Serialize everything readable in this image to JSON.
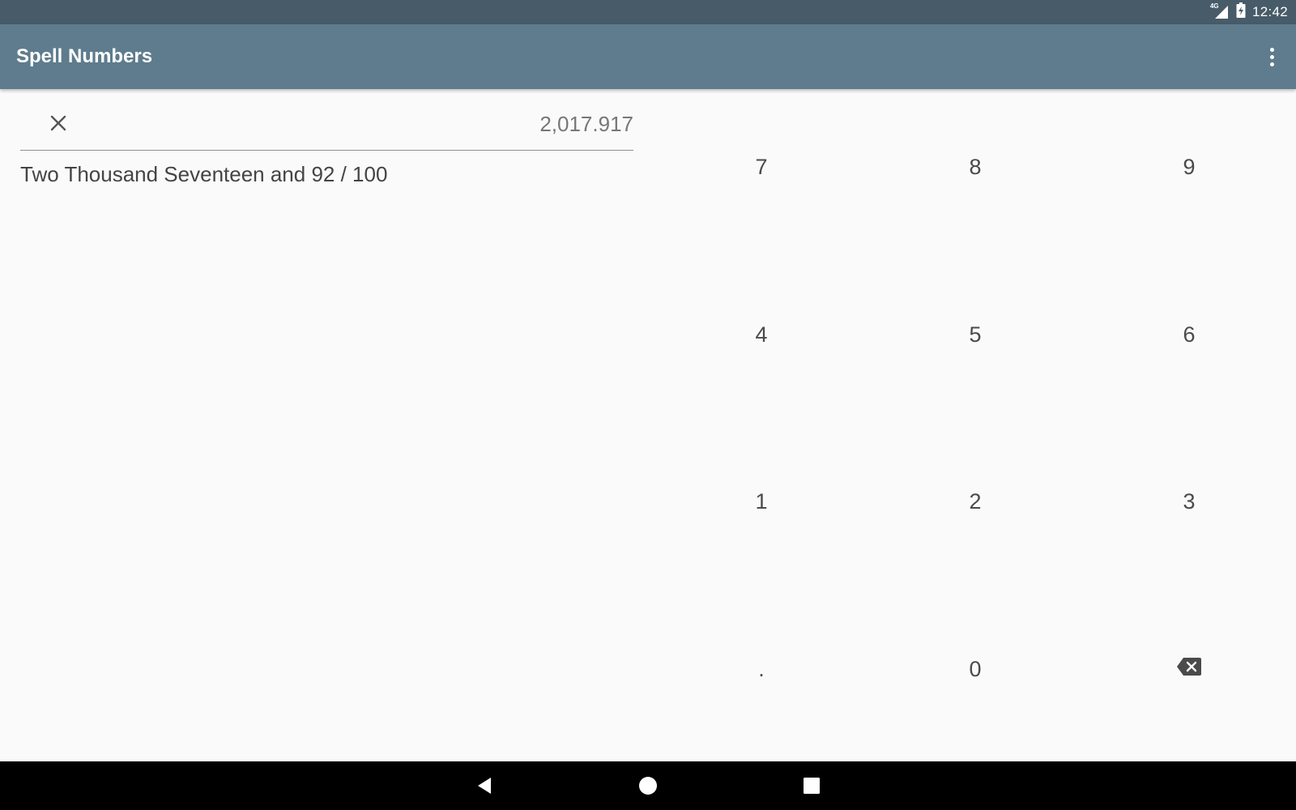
{
  "status_bar": {
    "network_label": "4G",
    "time": "12:42"
  },
  "app_bar": {
    "title": "Spell Numbers",
    "overflow_icon": "more-vert-icon"
  },
  "input": {
    "value": "2,017.917",
    "clear_icon": "close-icon"
  },
  "output": {
    "spelled_text": "Two Thousand Seventeen and 92 / 100"
  },
  "keypad": {
    "keys": [
      "7",
      "8",
      "9",
      "4",
      "5",
      "6",
      "1",
      "2",
      "3",
      ".",
      "0"
    ],
    "backspace_icon": "backspace-icon"
  },
  "nav_bar": {
    "back_icon": "back-triangle-icon",
    "home_icon": "home-circle-icon",
    "recents_icon": "recents-square-icon"
  },
  "colors": {
    "status_bar": "#475b68",
    "app_bar": "#5e7c8d",
    "background": "#fafafb",
    "nav_bar": "#000000"
  }
}
